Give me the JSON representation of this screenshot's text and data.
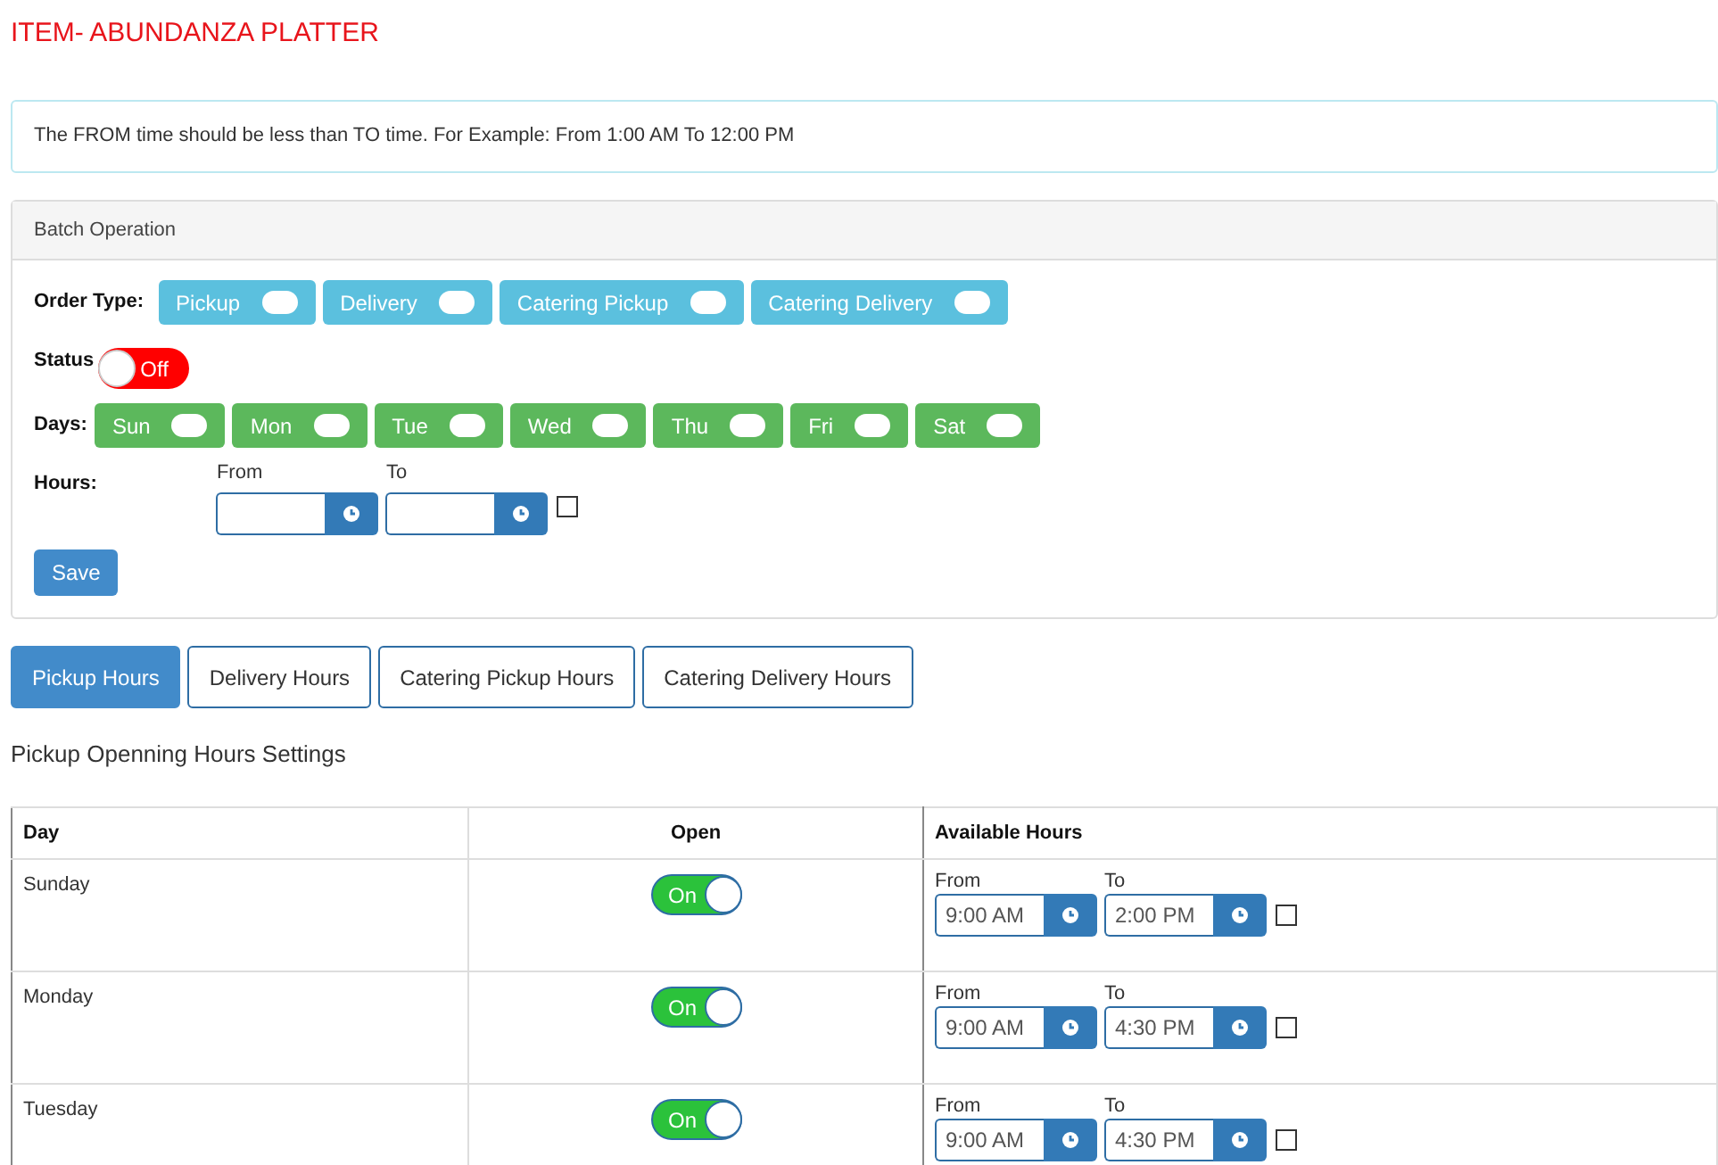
{
  "title": "ITEM- ABUNDANZA PLATTER",
  "alert": "The FROM time should be less than TO time. For Example: From 1:00 AM To 12:00 PM",
  "batch": {
    "heading": "Batch Operation",
    "order_type_label": "Order Type:",
    "order_types": [
      {
        "label": "Pickup",
        "on": false
      },
      {
        "label": "Delivery",
        "on": false
      },
      {
        "label": "Catering Pickup",
        "on": false
      },
      {
        "label": "Catering Delivery",
        "on": false
      }
    ],
    "status_label": "Status",
    "status": {
      "label": "Off",
      "on": false
    },
    "days_label": "Days:",
    "days": [
      {
        "label": "Sun",
        "on": false
      },
      {
        "label": "Mon",
        "on": false
      },
      {
        "label": "Tue",
        "on": false
      },
      {
        "label": "Wed",
        "on": false
      },
      {
        "label": "Thu",
        "on": false
      },
      {
        "label": "Fri",
        "on": false
      },
      {
        "label": "Sat",
        "on": false
      }
    ],
    "hours_label": "Hours:",
    "from_label": "From",
    "to_label": "To",
    "checked": false,
    "save": "Save"
  },
  "tabs": [
    {
      "label": "Pickup Hours",
      "selected": true
    },
    {
      "label": "Delivery Hours",
      "selected": false
    },
    {
      "label": "Catering Pickup Hours",
      "selected": false
    },
    {
      "label": "Catering Delivery Hours",
      "selected": false
    }
  ],
  "section_title": "Pickup Openning Hours Settings",
  "table": {
    "columns": [
      "Day",
      "Open",
      "Available Hours"
    ],
    "rows": [
      {
        "day": "Sunday",
        "open": {
          "label": "On",
          "on": true
        },
        "from_label": "From",
        "from": "9:00 AM",
        "to_label": "To",
        "to": "2:00 PM",
        "checked": false
      },
      {
        "day": "Monday",
        "open": {
          "label": "On",
          "on": true
        },
        "from_label": "From",
        "from": "9:00 AM",
        "to_label": "To",
        "to": "4:30 PM",
        "checked": false
      },
      {
        "day": "Tuesday",
        "open": {
          "label": "On",
          "on": true
        },
        "from_label": "From",
        "from": "9:00 AM",
        "to_label": "To",
        "to": "4:30 PM",
        "checked": false
      }
    ]
  }
}
